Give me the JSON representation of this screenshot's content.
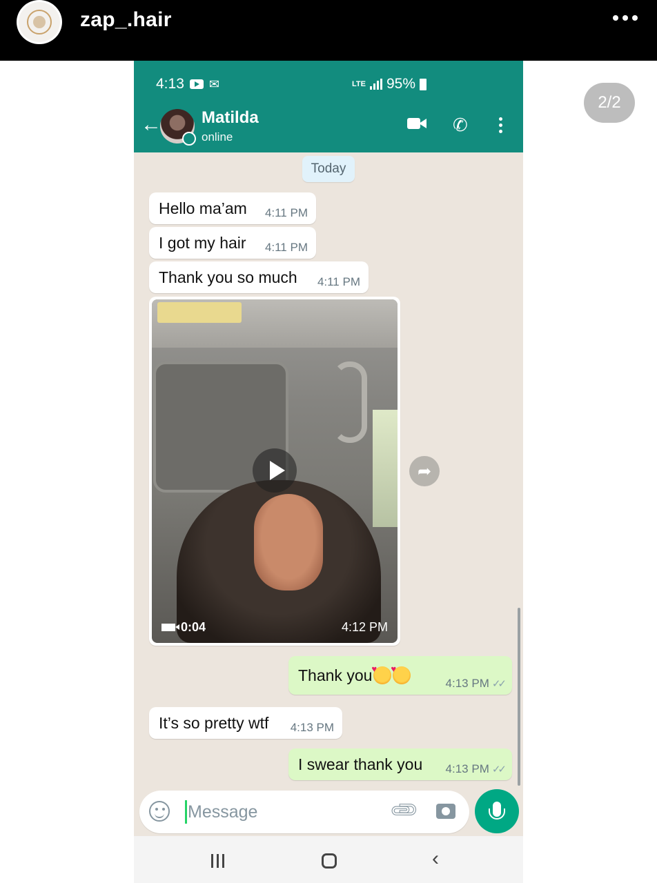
{
  "story": {
    "username": "zap_.hair",
    "page_indicator": "2/2"
  },
  "status_bar": {
    "time": "4:13",
    "network": "LTE",
    "battery": "95%"
  },
  "contact": {
    "name": "Matilda",
    "status": "online"
  },
  "chat": {
    "date_chip": "Today",
    "messages": [
      {
        "direction": "in",
        "text": "Hello ma’am",
        "time": "4:11 PM"
      },
      {
        "direction": "in",
        "text": "I got my hair",
        "time": "4:11 PM"
      },
      {
        "direction": "in",
        "text": "Thank you so much",
        "time": "4:11 PM"
      },
      {
        "direction": "in",
        "type": "video",
        "duration": "0:04",
        "time": "4:12 PM"
      },
      {
        "direction": "out",
        "text": "Thank you",
        "time": "4:13 PM",
        "read": true
      },
      {
        "direction": "in",
        "text": "It’s so pretty wtf",
        "time": "4:13 PM"
      },
      {
        "direction": "out",
        "text": "I swear thank you",
        "time": "4:13 PM",
        "read": true
      }
    ]
  },
  "composer": {
    "placeholder": "Message"
  },
  "icons": {
    "header": [
      "back-arrow-icon",
      "video-call-icon",
      "voice-call-icon",
      "more-menu-icon"
    ],
    "composer": [
      "emoji-icon",
      "attach-icon",
      "camera-icon",
      "mic-icon"
    ]
  },
  "colors": {
    "header_green": "#128c7e",
    "chat_bg": "#ece5dd",
    "outgoing_bubble": "#dcf8c6",
    "mic_button": "#00a884"
  }
}
